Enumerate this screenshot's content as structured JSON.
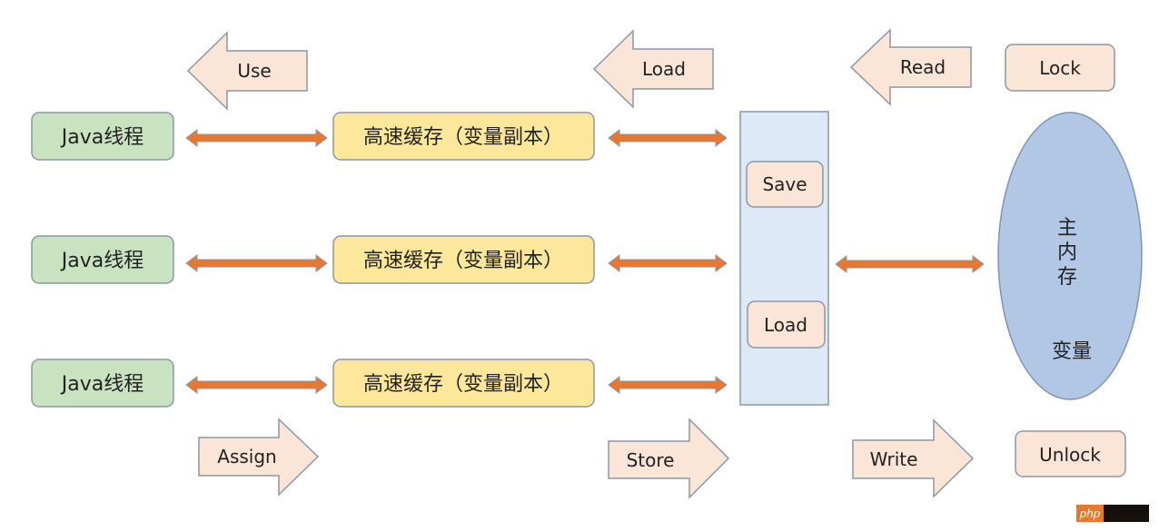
{
  "colors": {
    "thread_fill": "#c9e2c0",
    "cache_fill": "#fde79b",
    "op_fill": "#fbe5d7",
    "buffer_fill": "#dde9f6",
    "memory_fill": "#b2c7e6",
    "connector": "#e8782f",
    "outline": "#8a97a8"
  },
  "top_ops": {
    "use": "Use",
    "load": "Load",
    "read": "Read",
    "lock": "Lock"
  },
  "bottom_ops": {
    "assign": "Assign",
    "store": "Store",
    "write": "Write",
    "unlock": "Unlock"
  },
  "threads": [
    "Java线程",
    "Java线程",
    "Java线程"
  ],
  "caches": [
    "高速缓存（变量副本）",
    "高速缓存（变量副本）",
    "高速缓存（变量副本）"
  ],
  "buffer": {
    "save": "Save",
    "load": "Load"
  },
  "main_memory": {
    "title_chars": [
      "主",
      "内",
      "存"
    ],
    "variable": "变量"
  },
  "watermark": "php"
}
